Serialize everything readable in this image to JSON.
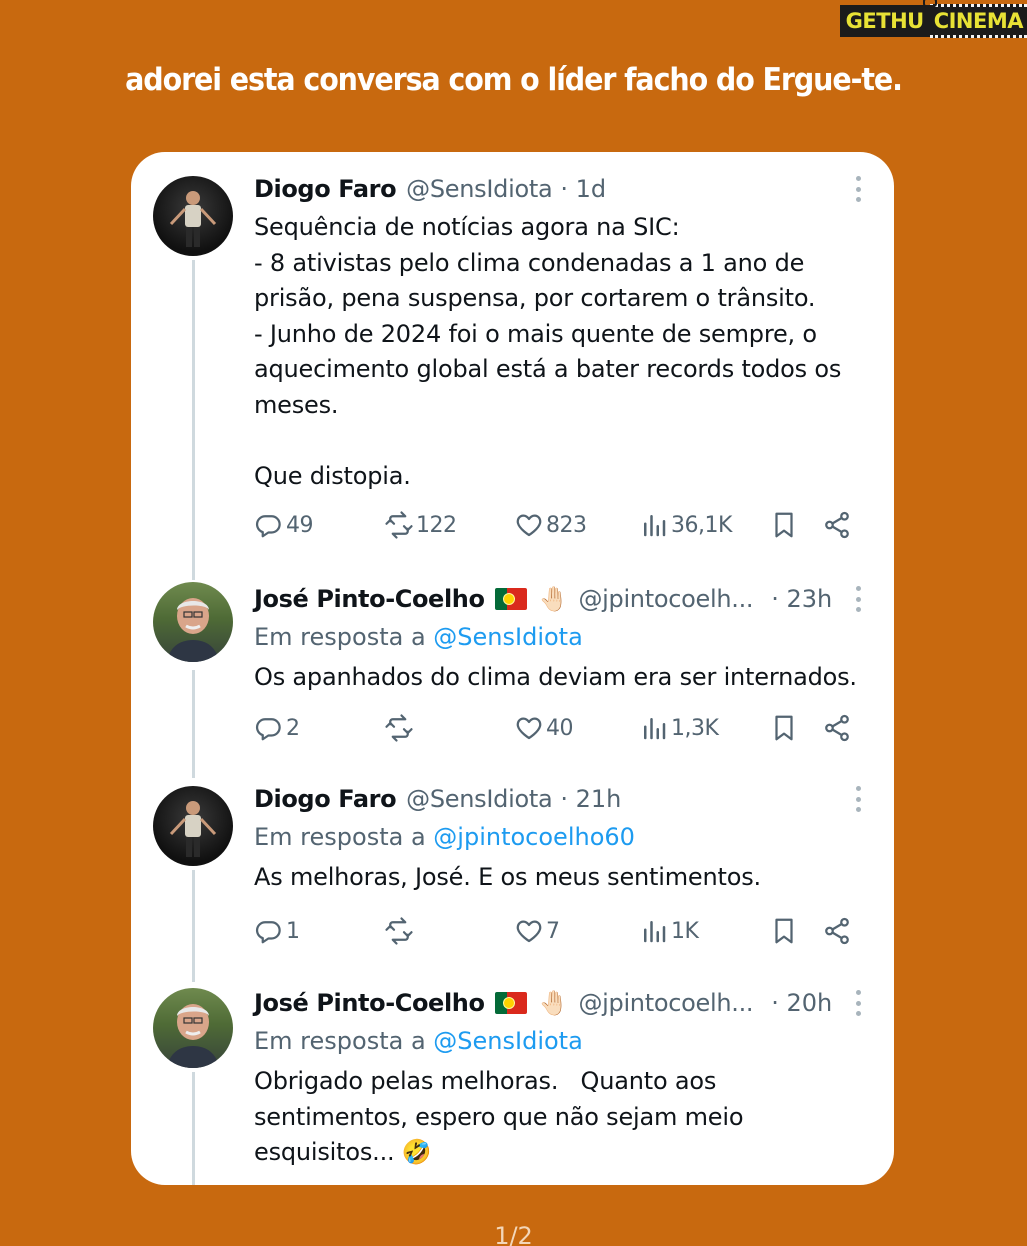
{
  "watermark": {
    "part1": "GETHU",
    "part2": "CINEMA"
  },
  "caption": "adorei esta conversa com o líder facho do Ergue-te.",
  "tweets": [
    {
      "name": "Diogo Faro",
      "handle": "@SensIdiota",
      "time": "· 1d",
      "reply_prefix": "",
      "reply_mention": "",
      "body": "Sequência de notícias agora na SIC:\n- 8 ativistas pelo clima condenadas a 1 ano de prisão, pena suspensa, por cortarem o trânsito.\n- Junho de 2024 foi o mais quente de sempre, o aquecimento global está a bater records todos os meses.\n\nQue distopia.",
      "replies": "49",
      "retweets": "122",
      "likes": "823",
      "views": "36,1K"
    },
    {
      "name": "José Pinto-Coelho",
      "emoji_hand": "🤚🏻",
      "handle": "@jpintocoelh...",
      "time": "· 23h",
      "reply_prefix": "Em resposta a ",
      "reply_mention": "@SensIdiota",
      "body": "Os apanhados do clima deviam era ser internados.",
      "replies": "2",
      "retweets": "",
      "likes": "40",
      "views": "1,3K"
    },
    {
      "name": "Diogo Faro",
      "handle": "@SensIdiota",
      "time": "· 21h",
      "reply_prefix": "Em resposta a ",
      "reply_mention": "@jpintocoelho60",
      "body": "As melhoras, José. E os meus sentimentos.",
      "replies": "1",
      "retweets": "",
      "likes": "7",
      "views": "1K"
    },
    {
      "name": "José Pinto-Coelho",
      "emoji_hand": "🤚🏻",
      "handle": "@jpintocoelh...",
      "time": "· 20h",
      "reply_prefix": "Em resposta a ",
      "reply_mention": "@SensIdiota",
      "body": "Obrigado pelas melhoras.   Quanto aos sentimentos, espero que não sejam meio esquisitos... 🤣"
    }
  ],
  "pager": "1/2",
  "colors": {
    "background": "#c8690f",
    "link": "#1d9bf0",
    "muted": "#536471"
  },
  "icons": [
    "reply-icon",
    "retweet-icon",
    "like-icon",
    "views-icon",
    "bookmark-icon",
    "share-icon",
    "more-icon"
  ]
}
